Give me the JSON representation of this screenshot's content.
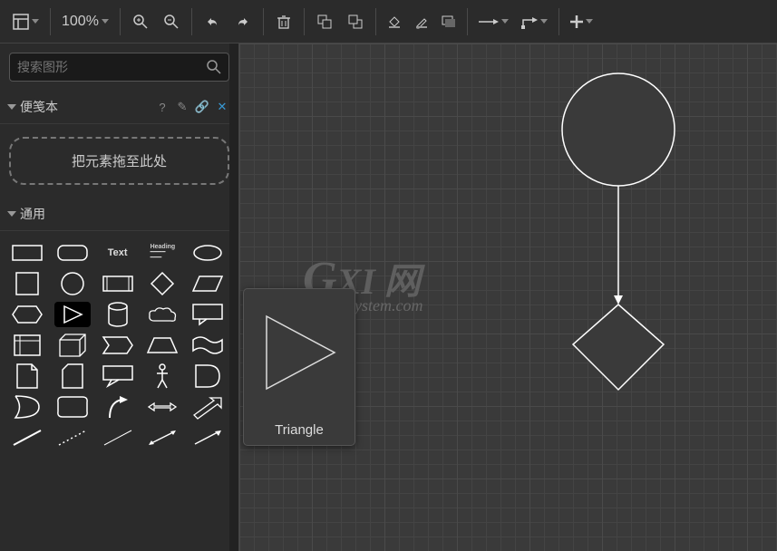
{
  "toolbar": {
    "zoom": "100%"
  },
  "search": {
    "placeholder": "搜索图形"
  },
  "scratchpad": {
    "title": "便笺本",
    "help": "?",
    "drop_hint": "把元素拖至此处"
  },
  "general": {
    "title": "通用",
    "text_label": "Text",
    "heading_label": "Heading"
  },
  "preview": {
    "label": "Triangle"
  },
  "watermark": {
    "brand_g": "G",
    "brand_rest": "XI 网",
    "sub": "system.com"
  }
}
